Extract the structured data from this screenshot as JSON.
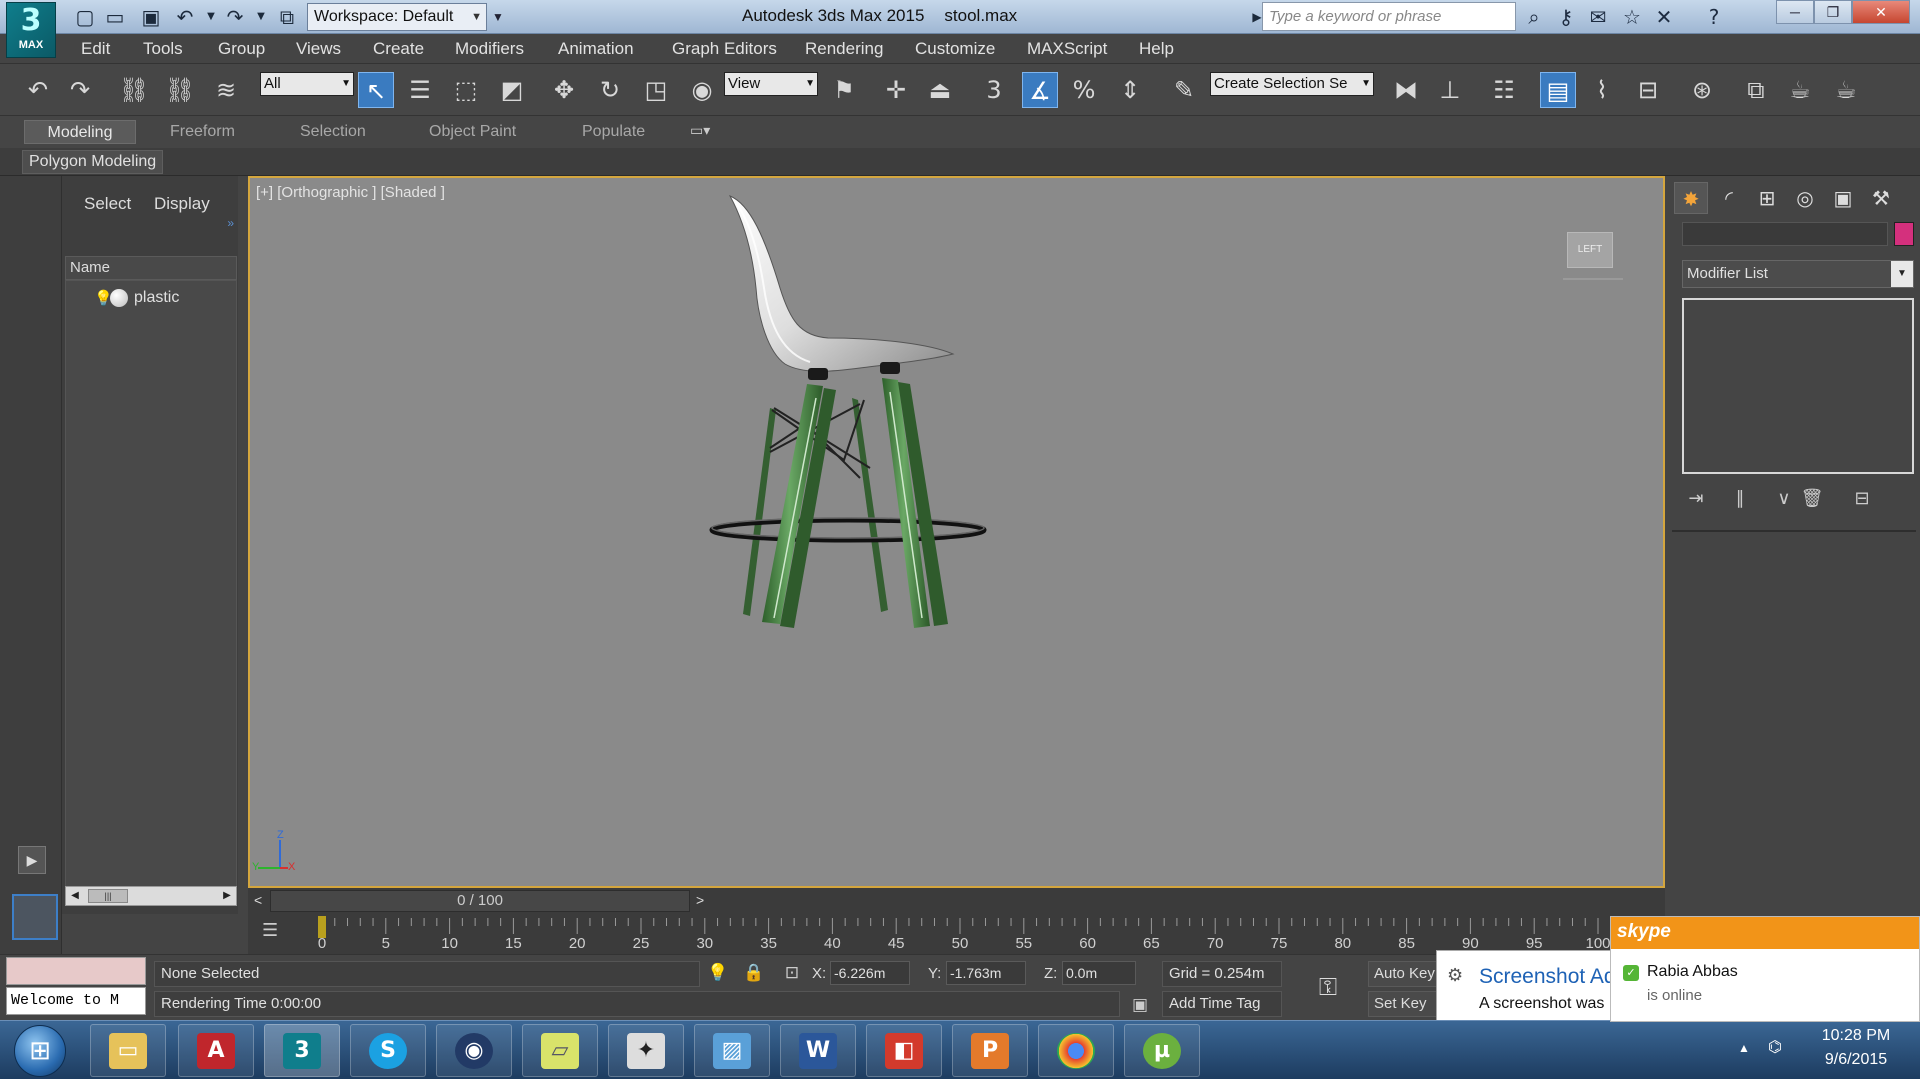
{
  "app": {
    "logo_label": "MAX",
    "workspace": "Workspace: Default",
    "product": "Autodesk 3ds Max  2015",
    "file": "stool.max",
    "search_placeholder": "Type a keyword or phrase"
  },
  "menu": [
    "Edit",
    "Tools",
    "Group",
    "Views",
    "Create",
    "Modifiers",
    "Animation",
    "Graph Editors",
    "Rendering",
    "Customize",
    "MAXScript",
    "Help"
  ],
  "toolbar": {
    "selection_filter": "All",
    "ref_coord": "View",
    "snap_angle_label": "3",
    "named_selection_placeholder": "Create Selection Se"
  },
  "ribbon": {
    "tabs": [
      "Modeling",
      "Freeform",
      "Selection",
      "Object Paint",
      "Populate"
    ],
    "active_tab": "Modeling",
    "panel_label": "Polygon Modeling"
  },
  "explorer": {
    "tabs": [
      "Select",
      "Display"
    ],
    "column": "Name",
    "items": [
      {
        "name": "plastic"
      }
    ]
  },
  "viewport": {
    "label": "[+] [Orthographic ] [Shaded ]",
    "viewcube": "LEFT",
    "axis_z": "Z",
    "axis_y": "Y",
    "axis_x": "X",
    "colors": {
      "background": "#8a8a8a",
      "legs": "#3f7d3c",
      "seat": "#e6e6e6",
      "border": "#d4a63e"
    }
  },
  "time_slider": {
    "prev": "<",
    "frame": "0 / 100",
    "next": ">"
  },
  "trackbar": {
    "ticks": [
      "0",
      "5",
      "10",
      "15",
      "20",
      "25",
      "30",
      "35",
      "40",
      "45",
      "50",
      "55",
      "60",
      "65",
      "70",
      "75",
      "80",
      "85",
      "90",
      "95",
      "100"
    ],
    "current_frame": 0
  },
  "command_panel": {
    "modifier_list": "Modifier List",
    "object_color": "#d4307d"
  },
  "status": {
    "maxscript_text": "Welcome to M",
    "selection": "None Selected",
    "rendering_time": "Rendering Time  0:00:00",
    "x_label": "X:",
    "x_value": "-6.226m",
    "y_label": "Y:",
    "y_value": "-1.763m",
    "z_label": "Z:",
    "z_value": "0.0m",
    "grid": "Grid = 0.254m",
    "add_time_tag": "Add Time Tag",
    "auto_key": "Auto Key",
    "set_key": "Set Key"
  },
  "notifications": {
    "screenshot_title": "Screenshot Ad",
    "screenshot_body": "A screenshot was",
    "skype_brand": "skype",
    "skype_name": "Rabia Abbas",
    "skype_status": "is online"
  },
  "taskbar": {
    "time": "10:28 PM",
    "date": "9/6/2015"
  }
}
